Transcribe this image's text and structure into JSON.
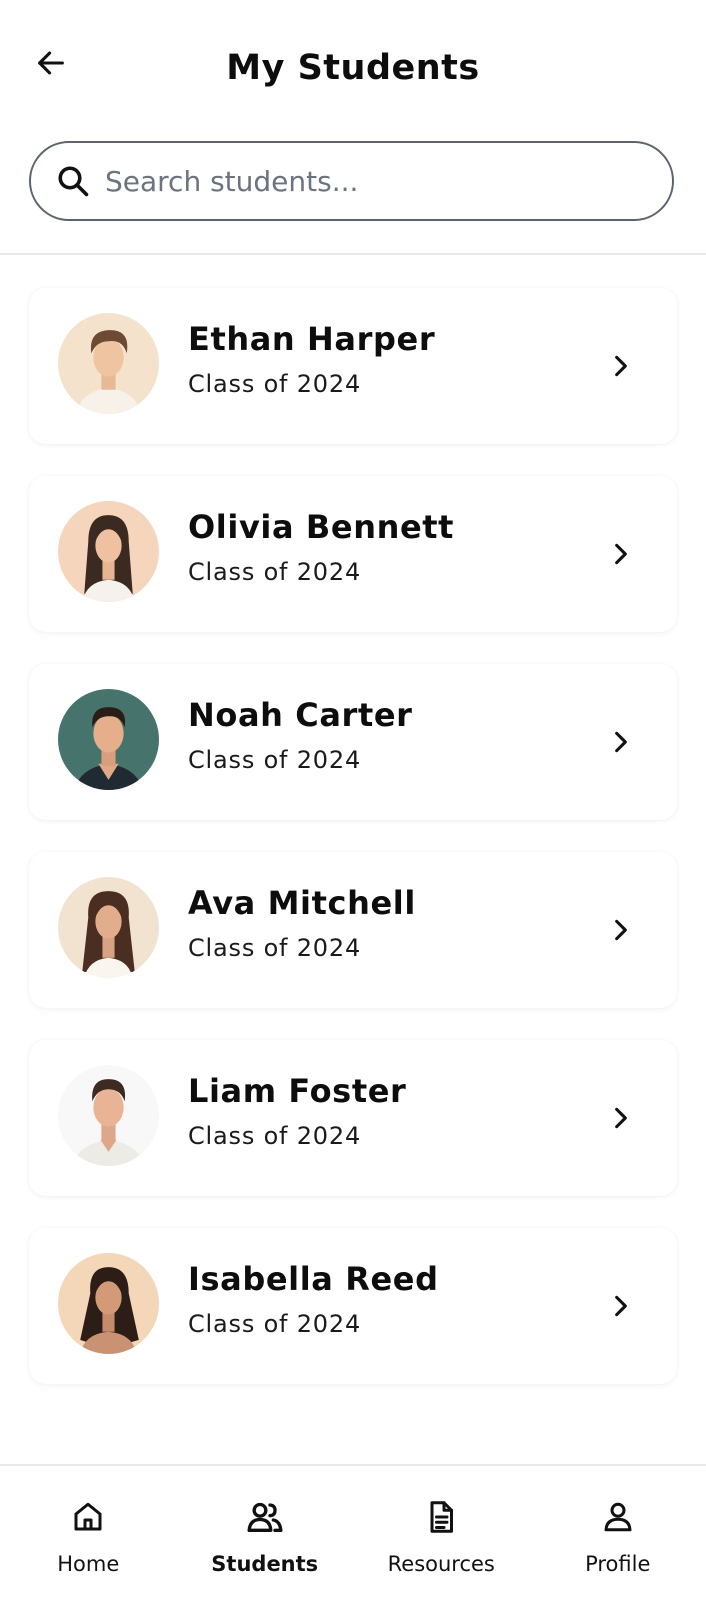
{
  "header": {
    "title": "My Students",
    "back_icon": "arrow-left-icon"
  },
  "search": {
    "placeholder": "Search students...",
    "value": "",
    "icon": "search-icon"
  },
  "students": [
    {
      "name": "Ethan Harper",
      "class_label": "Class of 2024",
      "avatar_bg": "#f4e2cc"
    },
    {
      "name": "Olivia Bennett",
      "class_label": "Class of 2024",
      "avatar_bg": "#f6d5bd"
    },
    {
      "name": "Noah Carter",
      "class_label": "Class of 2024",
      "avatar_bg": "#46736b"
    },
    {
      "name": "Ava Mitchell",
      "class_label": "Class of 2024",
      "avatar_bg": "#f2e3d1"
    },
    {
      "name": "Liam Foster",
      "class_label": "Class of 2024",
      "avatar_bg": "#f8f8f8"
    },
    {
      "name": "Isabella Reed",
      "class_label": "Class of 2024",
      "avatar_bg": "#f4d6b8"
    }
  ],
  "bottom_nav": {
    "items": [
      {
        "label": "Home",
        "icon": "home-icon",
        "active": false
      },
      {
        "label": "Students",
        "icon": "users-icon",
        "active": true
      },
      {
        "label": "Resources",
        "icon": "document-icon",
        "active": false
      },
      {
        "label": "Profile",
        "icon": "user-icon",
        "active": false
      }
    ]
  }
}
